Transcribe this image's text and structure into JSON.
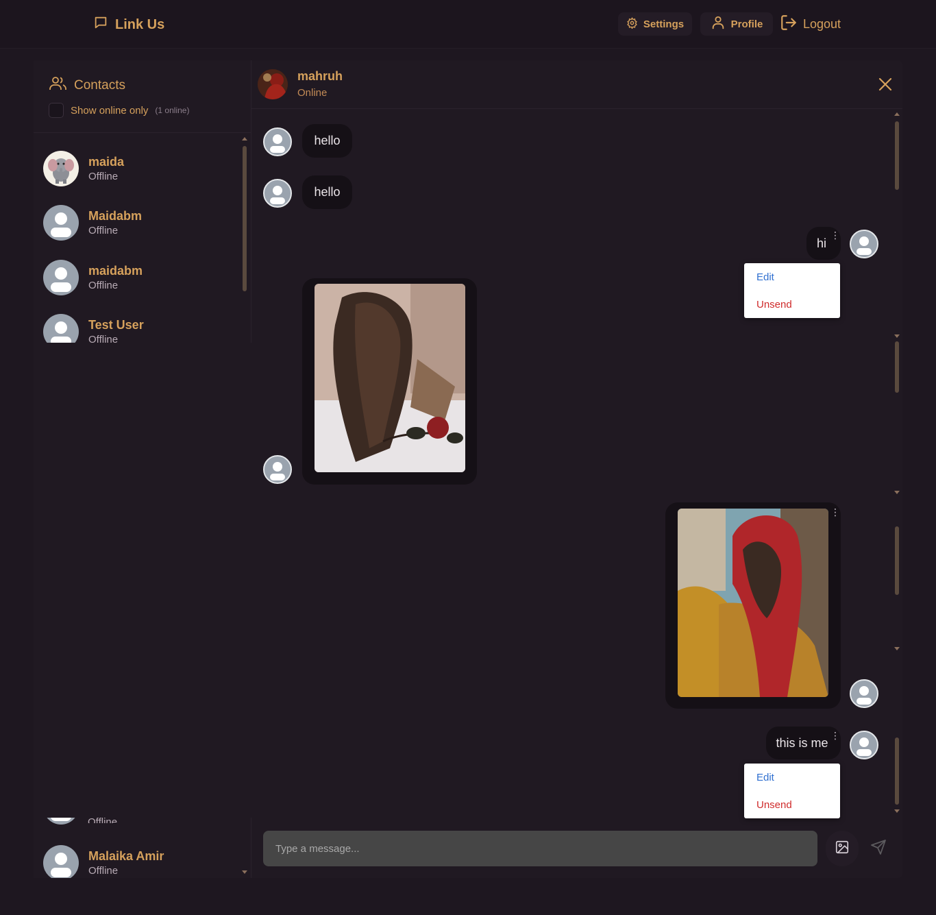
{
  "nav": {
    "brand": "Link Us",
    "settings": "Settings",
    "profile": "Profile",
    "logout": "Logout"
  },
  "sidebar": {
    "title": "Contacts",
    "online_filter": "Show online only",
    "online_count": "(1 online)",
    "contacts": [
      {
        "name": "maida",
        "status": "Offline"
      },
      {
        "name": "Maidabm",
        "status": "Offline"
      },
      {
        "name": "maidabm",
        "status": "Offline"
      },
      {
        "name": "Test User",
        "status": "Offline"
      },
      {
        "name": "Malaika Amir",
        "status": "Offline"
      }
    ],
    "partial_status": "Offline"
  },
  "chat": {
    "partner_name": "mahruh",
    "partner_status": "Online",
    "messages": [
      {
        "text": "hello"
      },
      {
        "text": "hello"
      },
      {
        "text": "hi"
      },
      {
        "text": "this is me"
      }
    ],
    "menu": {
      "edit": "Edit",
      "unsend": "Unsend"
    },
    "input_placeholder": "Type a message..."
  },
  "colors": {
    "accent": "#d6a15c",
    "background": "#1e1720",
    "bubble": "#151016",
    "edit": "#2f6fd0",
    "unsend": "#cf2a2a"
  }
}
